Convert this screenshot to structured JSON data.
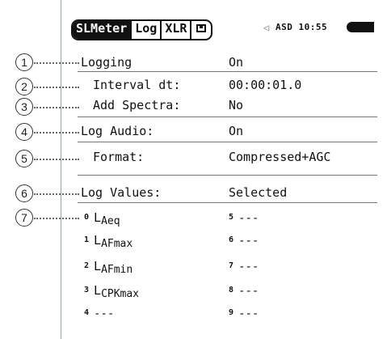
{
  "statusbar": {
    "tabs": [
      {
        "label": "SLMeter",
        "active": true
      },
      {
        "label": "Log",
        "active": false
      },
      {
        "label": "XLR",
        "active": false
      }
    ],
    "save_icon": "save-icon",
    "speaker_icon": "speaker-icon",
    "status_text": "ASD 10:55",
    "battery_icon": "battery-icon"
  },
  "callouts": [
    "1",
    "2",
    "3",
    "4",
    "5",
    "6",
    "7"
  ],
  "settings": [
    {
      "label": "Logging",
      "value": "On"
    },
    {
      "label": "Interval dt:",
      "value": "00:00:01.0"
    },
    {
      "label": "Add Spectra:",
      "value": "No"
    },
    {
      "label": "Log Audio:",
      "value": "On"
    },
    {
      "label": "Format:",
      "value": "Compressed+AGC"
    },
    {
      "label": "Log Values:",
      "value": "Selected"
    }
  ],
  "log_values": {
    "left": [
      {
        "index": "0",
        "sym": "L",
        "sub": "Aeq"
      },
      {
        "index": "1",
        "sym": "L",
        "sub": "AFmax"
      },
      {
        "index": "2",
        "sym": "L",
        "sub": "AFmin"
      },
      {
        "index": "3",
        "sym": "L",
        "sub": "CPKmax"
      },
      {
        "index": "4",
        "sym": "---",
        "sub": ""
      }
    ],
    "right": [
      {
        "index": "5",
        "text": "---"
      },
      {
        "index": "6",
        "text": "---"
      },
      {
        "index": "7",
        "text": "---"
      },
      {
        "index": "8",
        "text": "---"
      },
      {
        "index": "9",
        "text": "---"
      }
    ]
  }
}
